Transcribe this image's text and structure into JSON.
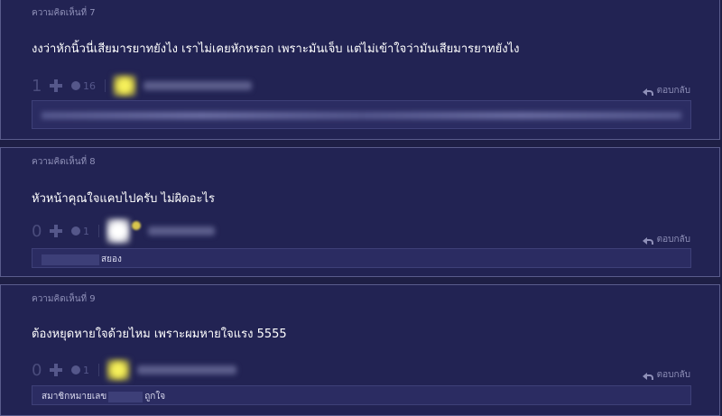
{
  "comments": [
    {
      "header": "ความคิดเห็นที่ 7",
      "text": "งงว่าหักนิ้วนี่เสียมารยาทยังไง เราไม่เคยหักหรอก เพราะมันเจ็บ แต่ไม่เข้าใจว่ามันเสียมารยาทยังไง",
      "votes": "1",
      "emotion_count": "16",
      "reply_label": "ตอบกลับ",
      "member_tail": ""
    },
    {
      "header": "ความคิดเห็นที่ 8",
      "text": "หัวหน้าคุณใจแคบไปครับ  ไม่ผิดอะไร",
      "votes": "0",
      "emotion_count": "1",
      "reply_label": "ตอบกลับ",
      "member_tail": "สยอง"
    },
    {
      "header": "ความคิดเห็นที่ 9",
      "text": "ต้องหยุดหายใจด้วยไหม เพราะผมหายใจแรง 5555",
      "votes": "0",
      "emotion_count": "1",
      "reply_label": "ตอบกลับ",
      "member_prefix": "สมาชิกหมายเลข",
      "member_tail": "ถูกใจ"
    }
  ],
  "icons": {
    "vote": "plus-icon",
    "emotion": "emotion-icon",
    "reply": "reply-icon"
  },
  "colors": {
    "page_bg": "#1e1f45",
    "card_bg": "#222353",
    "card_border": "#5a5c8c",
    "header_text": "#8f90b8",
    "sub_bg": "#2b2c62"
  }
}
